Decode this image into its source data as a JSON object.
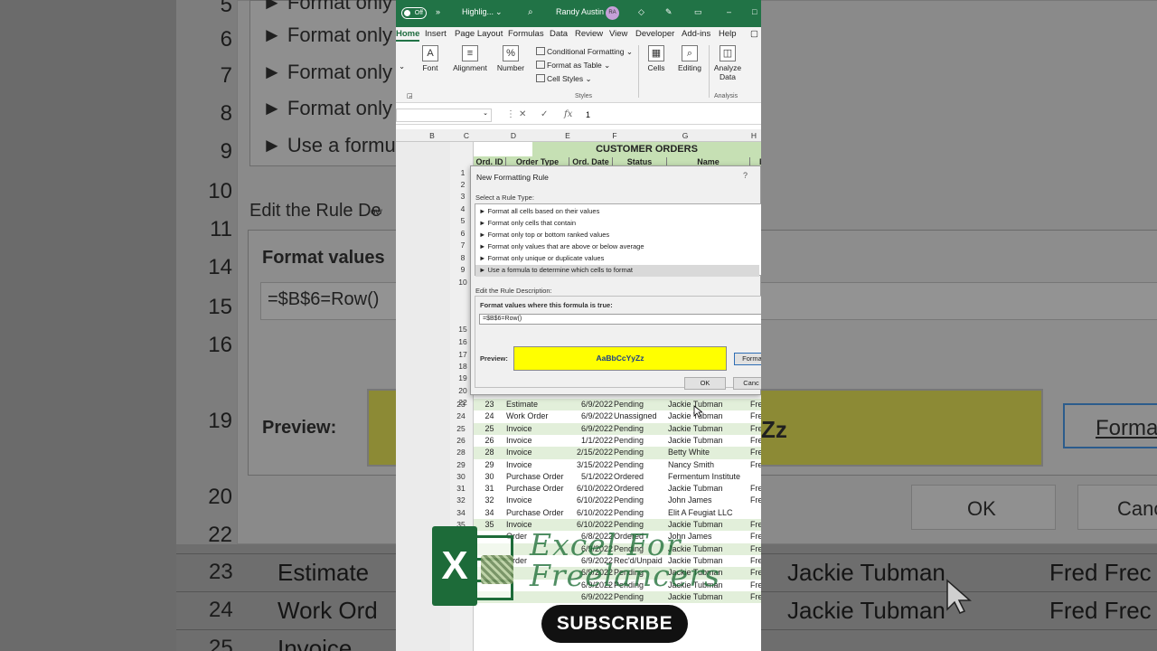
{
  "titlebar": {
    "autosave": "Off",
    "filename": "Highlig...",
    "user": "Randy Austin",
    "initials": "RA"
  },
  "tabs": [
    "Home",
    "Insert",
    "Page Layout",
    "Formulas",
    "Data",
    "Review",
    "View",
    "Developer",
    "Add-ins",
    "Help"
  ],
  "ribbon": {
    "font": "Font",
    "alignment": "Alignment",
    "number": "Number",
    "conditional_formatting": "Conditional Formatting",
    "format_as_table": "Format as Table",
    "cell_styles": "Cell Styles",
    "styles_group": "Styles",
    "cells": "Cells",
    "editing": "Editing",
    "analyze_data": "Analyze Data",
    "analysis_group": "Analysis"
  },
  "formula_bar": {
    "value": "1"
  },
  "columns": [
    "B",
    "C",
    "D",
    "E",
    "F",
    "G",
    "H"
  ],
  "sheet": {
    "title": "CUSTOMER ORDERS",
    "headers": [
      "Ord. ID",
      "Order Type",
      "Ord. Date",
      "Status",
      "Name",
      "Employ"
    ],
    "hidden_rows": [
      "1",
      "2",
      "3",
      "4",
      "5",
      "6",
      "7",
      "8",
      "9",
      "10",
      "15",
      "16",
      "17",
      "18",
      "19",
      "20",
      "22"
    ],
    "rows": [
      {
        "n": "23",
        "type": "Estimate",
        "date": "6/9/2022",
        "status": "Pending",
        "name": "Jackie Tubman",
        "emp": "Fred Fred"
      },
      {
        "n": "24",
        "type": "Work Order",
        "date": "6/9/2022",
        "status": "Unassigned",
        "name": "Jackie Tubman",
        "emp": "Fred Fred"
      },
      {
        "n": "25",
        "type": "Invoice",
        "date": "6/9/2022",
        "status": "Pending",
        "name": "Jackie Tubman",
        "emp": "Fred Fred"
      },
      {
        "n": "26",
        "type": "Invoice",
        "date": "1/1/2022",
        "status": "Pending",
        "name": "Jackie Tubman",
        "emp": "Fred Fred"
      },
      {
        "n": "28",
        "type": "Invoice",
        "date": "2/15/2022",
        "status": "Pending",
        "name": "Betty White",
        "emp": "Fred Fred"
      },
      {
        "n": "29",
        "type": "Invoice",
        "date": "3/15/2022",
        "status": "Pending",
        "name": "Nancy Smith",
        "emp": "Fred Fred"
      },
      {
        "n": "30",
        "type": "Purchase Order",
        "date": "5/1/2022",
        "status": "Ordered",
        "name": "Fermentum Institute",
        "emp": ""
      },
      {
        "n": "31",
        "type": "Purchase Order",
        "date": "6/10/2022",
        "status": "Ordered",
        "name": "Jackie Tubman",
        "emp": "Fred Fred"
      },
      {
        "n": "32",
        "type": "Invoice",
        "date": "6/10/2022",
        "status": "Pending",
        "name": "John James",
        "emp": "Fred Fred"
      },
      {
        "n": "34",
        "type": "Purchase Order",
        "date": "6/10/2022",
        "status": "Pending",
        "name": "Elit A Feugiat LLC",
        "emp": ""
      },
      {
        "n": "35",
        "type": "Invoice",
        "date": "6/10/2022",
        "status": "Pending",
        "name": "Jackie Tubman",
        "emp": "Fred Fred"
      },
      {
        "n": "",
        "type": "Order",
        "date": "6/8/2022",
        "status": "Ordered",
        "name": "John James",
        "emp": "Fred Fred"
      },
      {
        "n": "",
        "type": "",
        "date": "6/9/2022",
        "status": "Pending",
        "name": "Jackie Tubman",
        "emp": "Fred Fred"
      },
      {
        "n": "",
        "type": "Order",
        "date": "6/9/2022",
        "status": "Rec'd/Unpaid",
        "name": "Jackie Tubman",
        "emp": "Fred Fred"
      },
      {
        "n": "",
        "type": "",
        "date": "6/9/2022",
        "status": "Pending",
        "name": "Jackie Tubman",
        "emp": "Fred Fred"
      },
      {
        "n": "",
        "type": "",
        "date": "6/9/2022",
        "status": "Pending",
        "name": "Jackie Tubman",
        "emp": "Fred Fred"
      },
      {
        "n": "",
        "type": "",
        "date": "6/9/2022",
        "status": "Pending",
        "name": "Jackie Tubman",
        "emp": "Fred Fred"
      }
    ]
  },
  "dialog": {
    "title": "New Formatting Rule",
    "help": "?",
    "select_label": "Select a Rule Type:",
    "rule_types": [
      "► Format all cells based on their values",
      "► Format only cells that contain",
      "► Format only top or bottom ranked values",
      "► Format only values that are above or below average",
      "► Format only unique or duplicate values",
      "► Use a formula to determine which cells to format"
    ],
    "edit_label": "Edit the Rule Description:",
    "formula_label": "Format values where this formula is true:",
    "formula": "=$B$6=Row()",
    "preview_label": "Preview:",
    "preview_text": "AaBbCcYyZz",
    "format_button": "Forma",
    "ok": "OK",
    "cancel": "Canc"
  },
  "background": {
    "row_numbers": [
      "5",
      "6",
      "7",
      "8",
      "9",
      "10",
      "11",
      "14",
      "15",
      "16",
      "19",
      "20",
      "22",
      "23",
      "24",
      "25"
    ],
    "list_items": [
      "► Format only",
      "► Format only",
      "► Format only",
      "► Format only",
      "► Use a formu"
    ],
    "edit_label": "Edit the Rule De",
    "formula_label": "Format values",
    "formula": "=$B$6=Row()",
    "preview_label": "Preview:",
    "preview_tail": "Zz",
    "format_button": "Forma",
    "ok": "OK",
    "cancel": "Canc",
    "side_text": "ow",
    "bottom_rows": [
      {
        "n": "23",
        "type": "Estimate",
        "name": "Jackie Tubman",
        "emp": "Fred Frec"
      },
      {
        "n": "24",
        "type": "Work Ord",
        "name": "Jackie Tubman",
        "emp": "Fred Frec"
      },
      {
        "n": "25",
        "type": "Invoice",
        "name": "",
        "emp": ""
      }
    ]
  },
  "overlay": {
    "brand_line1": "Excel For",
    "brand_line2": "Freelancers",
    "excel_letter": "X",
    "subscribe": "SUBSCRIBE"
  }
}
